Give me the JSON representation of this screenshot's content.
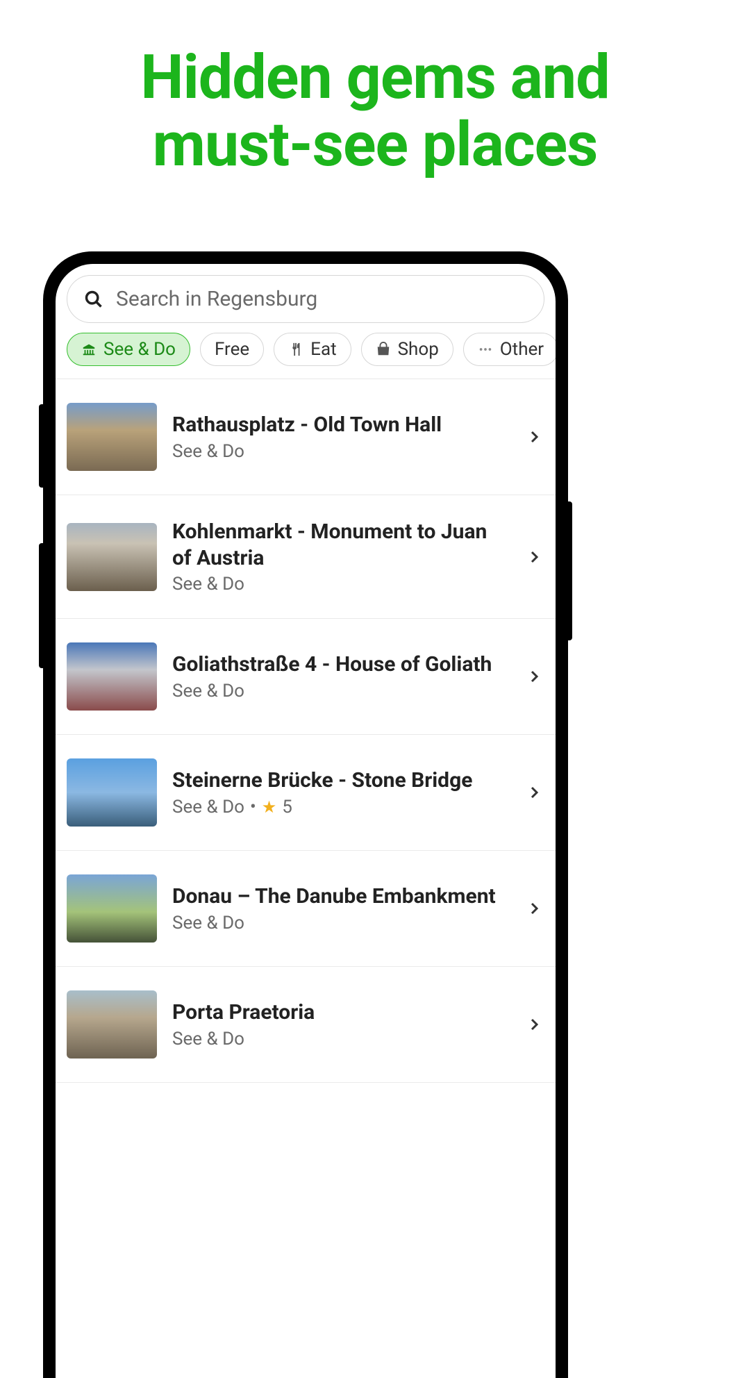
{
  "headline": {
    "line1": "Hidden gems and",
    "line2": "must-see places"
  },
  "search": {
    "placeholder": "Search in Regensburg"
  },
  "filters": [
    {
      "label": "See & Do",
      "icon": "museum-icon",
      "active": true
    },
    {
      "label": "Free",
      "icon": "",
      "active": false
    },
    {
      "label": "Eat",
      "icon": "utensils-icon",
      "active": false
    },
    {
      "label": "Shop",
      "icon": "bag-icon",
      "active": false
    },
    {
      "label": "Other",
      "icon": "dots-icon",
      "active": false
    }
  ],
  "places": [
    {
      "title": "Rathausplatz - Old Town Hall",
      "category": "See & Do",
      "rating": null,
      "thumbClass": "tg1"
    },
    {
      "title": "Kohlenmarkt - Monument to Juan of Austria",
      "category": "See & Do",
      "rating": null,
      "thumbClass": "tg2"
    },
    {
      "title": "Goliathstraße 4 - House of Goliath",
      "category": "See & Do",
      "rating": null,
      "thumbClass": "tg3"
    },
    {
      "title": "Steinerne Brücke - Stone Bridge",
      "category": "See & Do",
      "rating": "5",
      "thumbClass": "tg4"
    },
    {
      "title": "Donau – The Danube Embankment",
      "category": "See & Do",
      "rating": null,
      "thumbClass": "tg5"
    },
    {
      "title": "Porta Praetoria",
      "category": "See & Do",
      "rating": null,
      "thumbClass": "tg6"
    }
  ]
}
